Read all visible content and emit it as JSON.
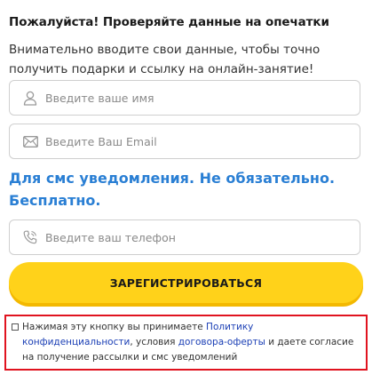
{
  "form": {
    "heading": "Пожалуйста! Проверяйте данные на опечатки",
    "intro": "Внимательно вводите свои данные, чтобы точно получить подарки и ссылку на онлайн-занятие!",
    "name_placeholder": "Введите ваше имя",
    "email_placeholder": "Введите Ваш Email",
    "sms_note": "Для смс уведомления. Не обязательно. Бесплатно.",
    "phone_placeholder": "Введите ваш телефон",
    "register_label": "ЗАРЕГИСТРИРОВАТЬСЯ"
  },
  "consent": {
    "text_1": "Нажимая эту кнопку вы принимаете ",
    "privacy_link": "Политику конфиденциальности",
    "text_2": ", условия ",
    "offer_link": "договора-оферты",
    "text_3": " и даете согласие на получение рассылки и смс уведомлений",
    "checked": false
  },
  "icons": {
    "name": "user-icon",
    "email": "envelope-icon",
    "phone": "phone-icon"
  },
  "colors": {
    "accent_blue": "#2a7fd4",
    "button_yellow": "#ffd21a",
    "link_blue": "#1b3fb5",
    "highlight_red": "#e0131f"
  }
}
